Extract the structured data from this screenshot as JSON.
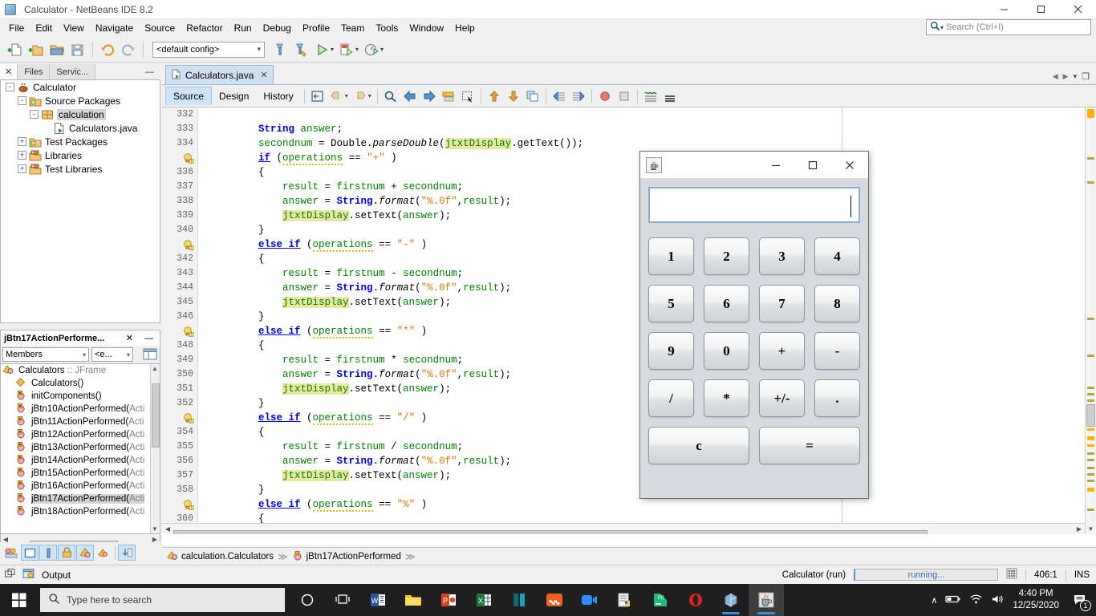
{
  "window": {
    "title": "Calculator - NetBeans IDE 8.2",
    "icon": "netbeans-cube-icon",
    "minimize": "–",
    "maximize": "□",
    "close": "✕"
  },
  "menubar": {
    "items": [
      "File",
      "Edit",
      "View",
      "Navigate",
      "Source",
      "Refactor",
      "Run",
      "Debug",
      "Profile",
      "Team",
      "Tools",
      "Window",
      "Help"
    ]
  },
  "search": {
    "placeholder": "Search (Ctrl+I)",
    "icon": "search-icon"
  },
  "toolbar": {
    "config_value": "<default config>",
    "buttons": [
      "new-file-icon",
      "new-project-icon",
      "open-project-icon",
      "save-all-icon",
      "undo-icon",
      "redo-icon",
      "build-project-icon",
      "clean-build-icon",
      "run-project-icon",
      "debug-project-icon",
      "profile-project-icon"
    ]
  },
  "left_panel": {
    "tabs": [
      {
        "label": "✕",
        "name": "projects-close"
      },
      {
        "label": "Files",
        "name": "files-tab"
      },
      {
        "label": "Servic...",
        "name": "services-tab"
      },
      {
        "label": "—",
        "name": "minimize-panel"
      }
    ],
    "tree": [
      {
        "label": "Calculator",
        "indent": 0,
        "expander": "-",
        "icon": "java-project-icon",
        "selected": false
      },
      {
        "label": "Source Packages",
        "indent": 1,
        "expander": "-",
        "icon": "source-packages-icon",
        "selected": false
      },
      {
        "label": "calculation",
        "indent": 2,
        "expander": "-",
        "icon": "package-icon",
        "selected": true
      },
      {
        "label": "Calculators.java",
        "indent": 3,
        "expander": "",
        "icon": "java-file-icon",
        "selected": false
      },
      {
        "label": "Test Packages",
        "indent": 1,
        "expander": "+",
        "icon": "test-packages-icon",
        "selected": false
      },
      {
        "label": "Libraries",
        "indent": 1,
        "expander": "+",
        "icon": "libraries-icon",
        "selected": false
      },
      {
        "label": "Test Libraries",
        "indent": 1,
        "expander": "+",
        "icon": "test-libraries-icon",
        "selected": false
      }
    ],
    "navigator": {
      "title": "jBtn17ActionPerforme...",
      "close": "✕",
      "minimize": "—",
      "filter_value": "Members",
      "scope_value": "<e...",
      "root": "Calculators",
      "root_type": ":: JFrame",
      "items": [
        {
          "label": "Calculators()",
          "icon": "constructor-icon",
          "selected": false,
          "dim": ""
        },
        {
          "label": "initComponents()",
          "icon": "method-icon",
          "selected": false,
          "dim": ""
        },
        {
          "label": "jBtn10ActionPerformed(",
          "dim": "Acti",
          "icon": "method-icon",
          "selected": false
        },
        {
          "label": "jBtn11ActionPerformed(",
          "dim": "Acti",
          "icon": "method-icon",
          "selected": false
        },
        {
          "label": "jBtn12ActionPerformed(",
          "dim": "Acti",
          "icon": "method-icon",
          "selected": false
        },
        {
          "label": "jBtn13ActionPerformed(",
          "dim": "Acti",
          "icon": "method-icon",
          "selected": false
        },
        {
          "label": "jBtn14ActionPerformed(",
          "dim": "Acti",
          "icon": "method-icon",
          "selected": false
        },
        {
          "label": "jBtn15ActionPerformed(",
          "dim": "Acti",
          "icon": "method-icon",
          "selected": false
        },
        {
          "label": "jBtn16ActionPerformed(",
          "dim": "Acti",
          "icon": "method-icon",
          "selected": false
        },
        {
          "label": "jBtn17ActionPerformed(",
          "dim": "Acti",
          "icon": "method-icon",
          "selected": true
        },
        {
          "label": "jBtn18ActionPerformed(",
          "dim": "Acti",
          "icon": "method-icon",
          "selected": false
        }
      ]
    },
    "bottom_strip": [
      "group-icon",
      "window-mode-icon",
      "split-icon",
      "lock-icon",
      "class-icon",
      "inherited-icon",
      "sort-icon"
    ]
  },
  "editor": {
    "tab": {
      "label": "Calculators.java",
      "close": "✕",
      "icon": "java-file-icon"
    },
    "view_tabs": [
      {
        "label": "Source",
        "active": true
      },
      {
        "label": "Design",
        "active": false
      },
      {
        "label": "History",
        "active": false
      }
    ],
    "margin_note": "",
    "lines": [
      {
        "num": "332",
        "bulb": false,
        "text": ""
      },
      {
        "num": "333",
        "bulb": false,
        "text": "        String answer;"
      },
      {
        "num": "334",
        "bulb": false,
        "text": "        secondnum = Double.parseDouble(jtxtDisplay.getText());"
      },
      {
        "num": "",
        "bulb": true,
        "text": "        if (operations == \"+\" )"
      },
      {
        "num": "336",
        "bulb": false,
        "text": "        {"
      },
      {
        "num": "337",
        "bulb": false,
        "text": "            result = firstnum + secondnum;"
      },
      {
        "num": "338",
        "bulb": false,
        "text": "            answer = String.format(\"%.0f\",result);"
      },
      {
        "num": "339",
        "bulb": false,
        "text": "            jtxtDisplay.setText(answer);"
      },
      {
        "num": "340",
        "bulb": false,
        "text": "        }"
      },
      {
        "num": "",
        "bulb": true,
        "text": "        else if (operations == \"-\" )"
      },
      {
        "num": "342",
        "bulb": false,
        "text": "        {"
      },
      {
        "num": "343",
        "bulb": false,
        "text": "            result = firstnum - secondnum;"
      },
      {
        "num": "344",
        "bulb": false,
        "text": "            answer = String.format(\"%.0f\",result);"
      },
      {
        "num": "345",
        "bulb": false,
        "text": "            jtxtDisplay.setText(answer);"
      },
      {
        "num": "346",
        "bulb": false,
        "text": "        }"
      },
      {
        "num": "",
        "bulb": true,
        "text": "        else if (operations == \"*\" )"
      },
      {
        "num": "348",
        "bulb": false,
        "text": "        {"
      },
      {
        "num": "349",
        "bulb": false,
        "text": "            result = firstnum * secondnum;"
      },
      {
        "num": "350",
        "bulb": false,
        "text": "            answer = String.format(\"%.0f\",result);"
      },
      {
        "num": "351",
        "bulb": false,
        "text": "            jtxtDisplay.setText(answer);"
      },
      {
        "num": "352",
        "bulb": false,
        "text": "        }"
      },
      {
        "num": "",
        "bulb": true,
        "text": "        else if (operations == \"/\" )"
      },
      {
        "num": "354",
        "bulb": false,
        "text": "        {"
      },
      {
        "num": "355",
        "bulb": false,
        "text": "            result = firstnum / secondnum;"
      },
      {
        "num": "356",
        "bulb": false,
        "text": "            answer = String.format(\"%.0f\",result);"
      },
      {
        "num": "357",
        "bulb": false,
        "text": "            jtxtDisplay.setText(answer);"
      },
      {
        "num": "358",
        "bulb": false,
        "text": "        }"
      },
      {
        "num": "",
        "bulb": true,
        "text": "        else if (operations == \"%\" )"
      },
      {
        "num": "360",
        "bulb": false,
        "text": "        {"
      }
    ]
  },
  "breadcrumb": {
    "items": [
      {
        "label": "calculation.Calculators",
        "icon": "class-icon"
      },
      {
        "label": "jBtn17ActionPerformed",
        "icon": "method-icon"
      }
    ],
    "separator": "≫"
  },
  "statusbar": {
    "output_label": "Output",
    "task_label": "Calculator (run)",
    "progress_text": "running...",
    "caret_position": "406:1",
    "insert_mode": "INS"
  },
  "calculator": {
    "title": "",
    "icon": "java-coffee-icon",
    "minimize": "–",
    "maximize": "□",
    "close": "✕",
    "display_value": "",
    "keys": [
      {
        "label": "1",
        "wide": false
      },
      {
        "label": "2",
        "wide": false
      },
      {
        "label": "3",
        "wide": false
      },
      {
        "label": "4",
        "wide": false
      },
      {
        "label": "5",
        "wide": false
      },
      {
        "label": "6",
        "wide": false
      },
      {
        "label": "7",
        "wide": false
      },
      {
        "label": "8",
        "wide": false
      },
      {
        "label": "9",
        "wide": false
      },
      {
        "label": "0",
        "wide": false
      },
      {
        "label": "+",
        "wide": false
      },
      {
        "label": "-",
        "wide": false
      },
      {
        "label": "/",
        "wide": false
      },
      {
        "label": "*",
        "wide": false
      },
      {
        "label": "+/-",
        "wide": false
      },
      {
        "label": ".",
        "wide": false
      },
      {
        "label": "c",
        "wide": true
      },
      {
        "label": "=",
        "wide": true
      }
    ]
  },
  "taskbar": {
    "start": "windows-start-icon",
    "search_placeholder": "Type here to search",
    "search_icon": "search-icon",
    "items": [
      {
        "name": "cortana-icon",
        "glyph": "O",
        "color": "#ffffff",
        "active": false
      },
      {
        "name": "task-view-icon",
        "glyph": "⌸",
        "color": "#ffffff",
        "active": false
      },
      {
        "name": "word-icon",
        "glyph": "W",
        "color": "#2b579a",
        "active": false
      },
      {
        "name": "file-explorer-icon",
        "glyph": "▬",
        "color": "#ffc107",
        "active": false
      },
      {
        "name": "powerpoint-icon",
        "glyph": "P",
        "color": "#d24726",
        "active": false
      },
      {
        "name": "excel-icon",
        "glyph": "X",
        "color": "#217346",
        "active": false
      },
      {
        "name": "teal-app-icon",
        "glyph": "▌",
        "color": "#0f6b78",
        "active": false
      },
      {
        "name": "xampp-icon",
        "glyph": "∞",
        "color": "#f0601a",
        "active": false
      },
      {
        "name": "zoom-icon",
        "glyph": "▶",
        "color": "#2d8cff",
        "active": false
      },
      {
        "name": "python-idle-icon",
        "glyph": "☰",
        "color": "#dedede",
        "active": false
      },
      {
        "name": "pycharm-icon",
        "glyph": "PC",
        "color": "#21d789",
        "active": false
      },
      {
        "name": "opera-icon",
        "glyph": "O",
        "color": "#e2231a",
        "active": false
      },
      {
        "name": "netbeans-icon",
        "glyph": "⬢",
        "color": "#8ab4d4",
        "active": false,
        "running": true
      },
      {
        "name": "java-app-icon",
        "glyph": "☕",
        "color": "#e0e0e0",
        "active": true,
        "running": true
      }
    ],
    "tray": {
      "chevron": "∧",
      "battery_icon": "battery-icon",
      "wifi_icon": "wifi-icon",
      "volume_icon": "volume-icon",
      "time": "4:40 PM",
      "date": "12/25/2020",
      "notification_icon": "notification-icon",
      "notification_count": "1"
    }
  }
}
